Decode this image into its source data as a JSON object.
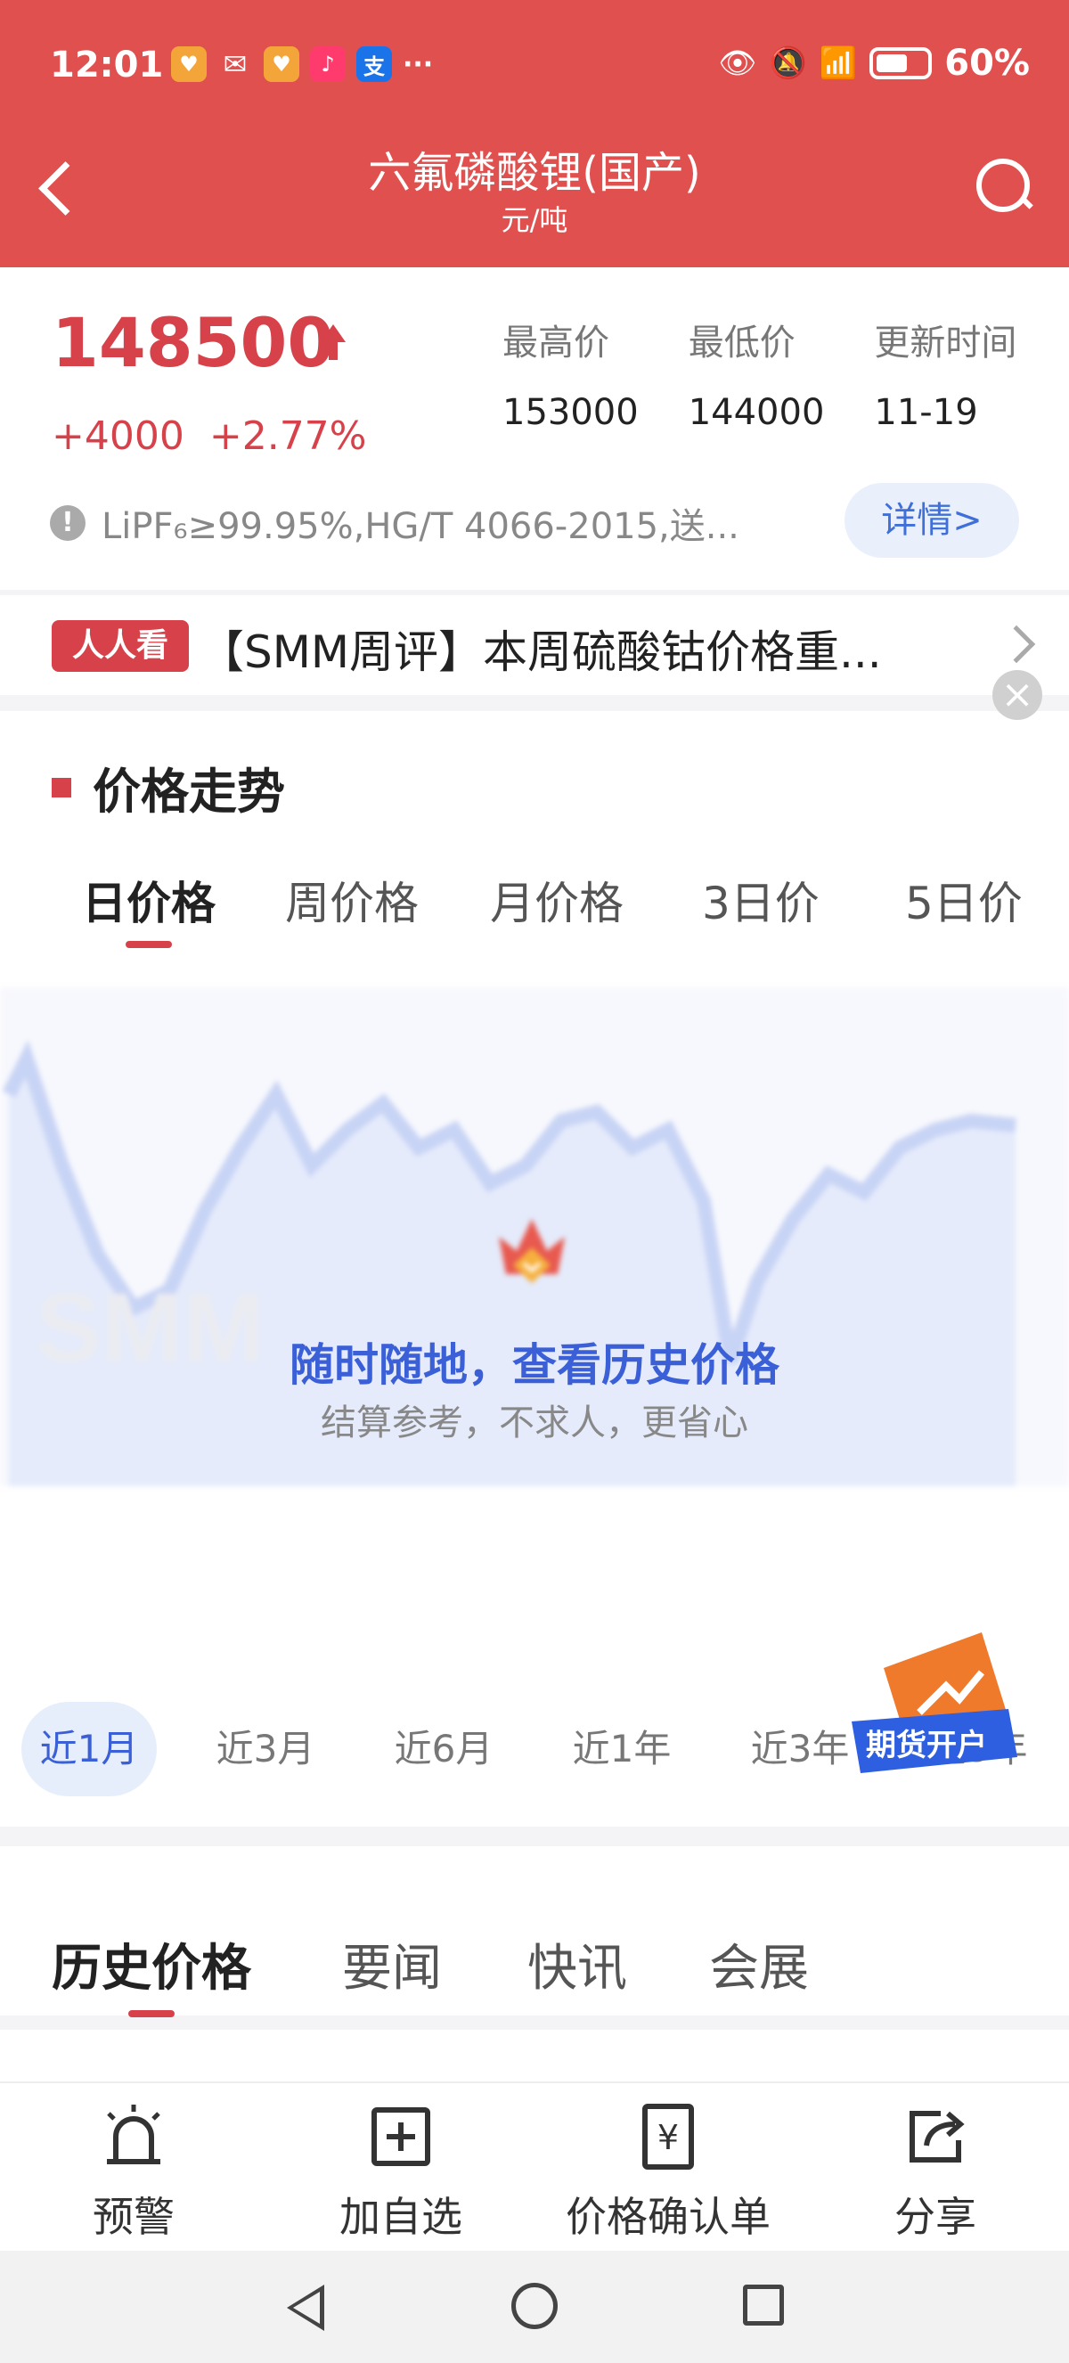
{
  "status_bar": {
    "time": "12:01",
    "battery": "60%",
    "app_icons": [
      "health-icon",
      "wechat-icon",
      "health-icon",
      "music-icon",
      "alipay-icon"
    ],
    "alipay_glyph": "支",
    "more": "···"
  },
  "header": {
    "title": "六氟磷酸锂(国产)",
    "unit": "元/吨"
  },
  "price": {
    "current": "148500",
    "change": "+4000",
    "change_pct": "+2.77%",
    "high_label": "最高价",
    "high": "153000",
    "low_label": "最低价",
    "low": "144000",
    "updated_label": "更新时间",
    "updated": "11-19",
    "spec": "LiPF₆≥99.95%,HG/T 4066-2015,送...",
    "detail_button": "详情>",
    "info_glyph": "!"
  },
  "news": {
    "tag": "人人看",
    "headline": "【SMM周评】本周硫酸钴价格重..."
  },
  "trend": {
    "section_title": "价格走势",
    "tabs": [
      "日价格",
      "周价格",
      "月价格",
      "3日价",
      "5日价"
    ],
    "overlay_title": "随时随地，查看历史价格",
    "overlay_subtitle": "结算参考，不求人，更省心",
    "watermark": "SMM",
    "ranges": [
      "近1月",
      "近3月",
      "近6月",
      "近1年",
      "近3年",
      "近5年"
    ],
    "ad_label": "期货开户",
    "close_glyph": "×"
  },
  "history_tabs": [
    "历史价格",
    "要闻",
    "快讯",
    "会展"
  ],
  "toolbar": {
    "alert": "预警",
    "add_watch": "加自选",
    "confirm": "价格确认单",
    "share": "分享"
  },
  "colors": {
    "brand_red": "#e0504f",
    "price_red": "#d7414a",
    "accent_blue": "#3a5fd6"
  }
}
